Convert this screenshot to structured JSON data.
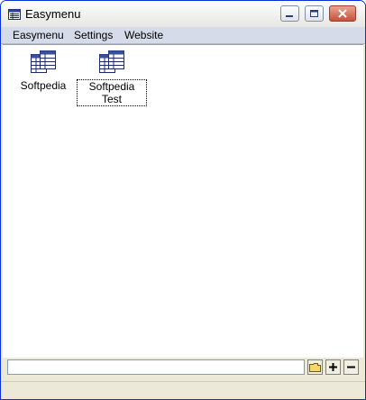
{
  "window": {
    "title": "Easymenu"
  },
  "menu": {
    "items": [
      "Easymenu",
      "Settings",
      "Website"
    ]
  },
  "shortcuts": [
    {
      "label": "Softpedia",
      "selected": false
    },
    {
      "label": "Softpedia Test",
      "selected": true
    }
  ],
  "bottom": {
    "path_value": ""
  },
  "colors": {
    "client_bg": "#ffffff",
    "menubar_bg": "#d6dbe9",
    "frame": "#ece9d8"
  },
  "icons": [
    "app-icon",
    "minimize-icon",
    "maximize-icon",
    "close-icon",
    "folder-icon",
    "plus-icon",
    "minus-icon"
  ]
}
